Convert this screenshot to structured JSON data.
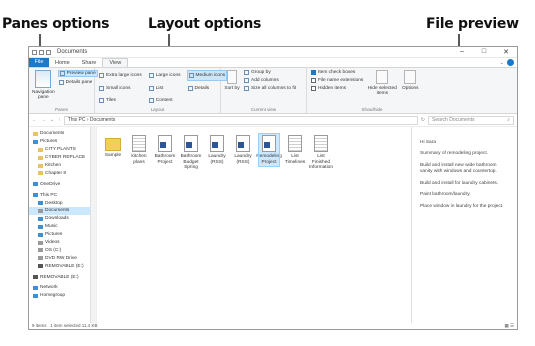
{
  "callouts": {
    "panes": "Panes options",
    "layout": "Layout options",
    "preview": "File preview"
  },
  "window": {
    "title": "Documents",
    "controls": [
      "–",
      "□",
      "✕"
    ]
  },
  "tabs": [
    {
      "label": "File"
    },
    {
      "label": "Home"
    },
    {
      "label": "Share"
    },
    {
      "label": "View"
    }
  ],
  "ribbon": {
    "panes": {
      "navigation_pane": "Navigation pane",
      "preview_pane": "Preview pane",
      "details_pane": "Details pane",
      "label": "Panes"
    },
    "layout": {
      "items": [
        "Extra large icons",
        "Large icons",
        "Medium icons",
        "Small icons",
        "List",
        "Details",
        "Tiles",
        "Content"
      ],
      "selected": "Medium icons",
      "label": "Layout"
    },
    "current_view": {
      "sort_by": "Sort by",
      "group_by": "Group by",
      "add_columns": "Add columns",
      "size_columns": "Size all columns to fit",
      "label": "Current view"
    },
    "show_hide": {
      "item_check_boxes": "Item check boxes",
      "file_name_extensions": "File name extensions",
      "hidden_items": "Hidden items",
      "hide_selected": "Hide selected items",
      "options": "Options",
      "label": "Show/hide"
    }
  },
  "address": {
    "path": "This PC › Documents",
    "search_placeholder": "Search Documents"
  },
  "nav": [
    {
      "label": "Documents",
      "icon": "documents-icon"
    },
    {
      "label": "Pictures",
      "icon": "pictures-icon"
    },
    {
      "label": "CITY PLANTS",
      "icon": "folder-icon"
    },
    {
      "label": "CYBER REPLACE",
      "icon": "folder-icon"
    },
    {
      "label": "Kitchen",
      "icon": "folder-icon"
    },
    {
      "label": "Chapter 8",
      "icon": "folder-icon"
    },
    {
      "label": "OneDrive",
      "icon": "cloud-icon"
    },
    {
      "label": "This PC",
      "icon": "computer-icon"
    },
    {
      "label": "Desktop",
      "icon": "desktop-icon"
    },
    {
      "label": "Documents",
      "icon": "documents-icon"
    },
    {
      "label": "Downloads",
      "icon": "downloads-icon"
    },
    {
      "label": "Music",
      "icon": "music-icon"
    },
    {
      "label": "Pictures",
      "icon": "pictures-icon"
    },
    {
      "label": "Videos",
      "icon": "videos-icon"
    },
    {
      "label": "OS (C:)",
      "icon": "drive-icon"
    },
    {
      "label": "DVD RW Drive",
      "icon": "dvd-icon"
    },
    {
      "label": "REMOVABLE (E:)",
      "icon": "usb-icon"
    },
    {
      "label": "REMOVABLE (E:)",
      "icon": "usb-icon"
    },
    {
      "label": "Network",
      "icon": "network-icon"
    },
    {
      "label": "Homegroup",
      "icon": "homegroup-icon"
    }
  ],
  "files": [
    {
      "name": "Sample",
      "type": "folder"
    },
    {
      "name": "kitchen plans",
      "type": "doc"
    },
    {
      "name": "Bathroom Project",
      "type": "word"
    },
    {
      "name": "Bathroom Budget Spring",
      "type": "word"
    },
    {
      "name": "Laundry (RSS)",
      "type": "word"
    },
    {
      "name": "Laundry (RSS)",
      "type": "word"
    },
    {
      "name": "Remodeling Project",
      "type": "word",
      "selected": true
    },
    {
      "name": "List Timelines",
      "type": "doc"
    },
    {
      "name": "List Finished Information",
      "type": "doc"
    }
  ],
  "preview": [
    "Hi Sara",
    "Summary of remodeling project.",
    "Build and install new wide bathroom vanity with windows and countertop.",
    "Build and install for laundry cabinets.",
    "Paint bathroom/laundry.",
    "Place window in laundry for the project."
  ],
  "status": {
    "items": "9 items",
    "selected": "1 item selected 11.4 KB"
  },
  "colors": {
    "accent": "#1979ca",
    "selection": "#cce8ff"
  }
}
